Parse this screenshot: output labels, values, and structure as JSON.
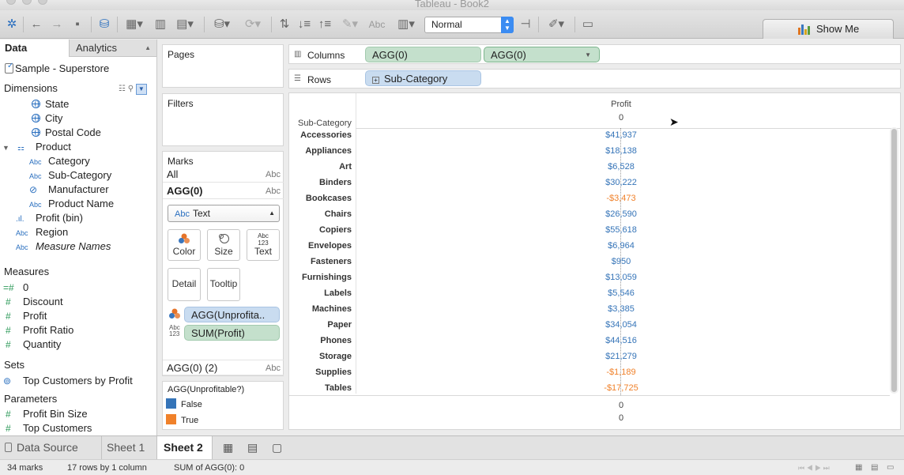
{
  "window": {
    "title": "Tableau - Book2"
  },
  "toolbar": {
    "fit_select": "Normal",
    "abc_label": "Abc",
    "show_me_label": "Show Me"
  },
  "left_panel": {
    "tabs": {
      "data": "Data",
      "analytics": "Analytics"
    },
    "data_source": "Sample - Superstore",
    "dimensions_header": "Dimensions",
    "dimensions": {
      "state": "State",
      "city": "City",
      "postal_code": "Postal Code",
      "product": "Product",
      "category": "Category",
      "sub_category": "Sub-Category",
      "manufacturer": "Manufacturer",
      "product_name": "Product Name",
      "profit_bin": "Profit (bin)",
      "region": "Region",
      "measure_names": "Measure Names"
    },
    "measures_header": "Measures",
    "measures": {
      "zero": "0",
      "discount": "Discount",
      "profit": "Profit",
      "profit_ratio": "Profit Ratio",
      "quantity": "Quantity"
    },
    "sets_header": "Sets",
    "sets": {
      "top_customers": "Top Customers by Profit"
    },
    "parameters_header": "Parameters",
    "parameters": {
      "profit_bin_size": "Profit Bin Size",
      "top_customers": "Top Customers"
    }
  },
  "cards": {
    "pages": "Pages",
    "filters": "Filters",
    "marks": {
      "header": "Marks",
      "all": "All",
      "agg0": "AGG(0)",
      "agg0_2": "AGG(0) (2)",
      "abc": "Abc",
      "mark_type": "Text",
      "color": "Color",
      "size": "Size",
      "text": "Text",
      "detail": "Detail",
      "tooltip": "Tooltip",
      "pill_color": "AGG(Unprofita..",
      "pill_text": "SUM(Profit)"
    },
    "legend": {
      "title": "AGG(Unprofitable?)",
      "items": [
        {
          "label": "False",
          "color": "#3574b8"
        },
        {
          "label": "True",
          "color": "#f0812a"
        }
      ]
    }
  },
  "shelves": {
    "columns_label": "Columns",
    "columns_pills": [
      "AGG(0)",
      "AGG(0)"
    ],
    "rows_label": "Rows",
    "rows_pill": "Sub-Category"
  },
  "view": {
    "column_header": "Profit",
    "top_axis_value": "0",
    "row_header": "Sub-Category",
    "rows": [
      {
        "label": "Accessories",
        "value": "$41,937",
        "profitable": true
      },
      {
        "label": "Appliances",
        "value": "$18,138",
        "profitable": true
      },
      {
        "label": "Art",
        "value": "$6,528",
        "profitable": true
      },
      {
        "label": "Binders",
        "value": "$30,222",
        "profitable": true
      },
      {
        "label": "Bookcases",
        "value": "-$3,473",
        "profitable": false
      },
      {
        "label": "Chairs",
        "value": "$26,590",
        "profitable": true
      },
      {
        "label": "Copiers",
        "value": "$55,618",
        "profitable": true
      },
      {
        "label": "Envelopes",
        "value": "$6,964",
        "profitable": true
      },
      {
        "label": "Fasteners",
        "value": "$950",
        "profitable": true
      },
      {
        "label": "Furnishings",
        "value": "$13,059",
        "profitable": true
      },
      {
        "label": "Labels",
        "value": "$5,546",
        "profitable": true
      },
      {
        "label": "Machines",
        "value": "$3,385",
        "profitable": true
      },
      {
        "label": "Paper",
        "value": "$34,054",
        "profitable": true
      },
      {
        "label": "Phones",
        "value": "$44,516",
        "profitable": true
      },
      {
        "label": "Storage",
        "value": "$21,279",
        "profitable": true
      },
      {
        "label": "Supplies",
        "value": "-$1,189",
        "profitable": false
      },
      {
        "label": "Tables",
        "value": "-$17,725",
        "profitable": false
      }
    ],
    "bottom_axis_values": [
      "0",
      "0"
    ],
    "colors": {
      "profitable": "#3574b8",
      "unprofitable": "#f0812a"
    }
  },
  "sheet_tabs": {
    "data_source": "Data Source",
    "sheet1": "Sheet 1",
    "sheet2": "Sheet 2"
  },
  "status": {
    "marks": "34 marks",
    "rows_cols": "17 rows by 1 column",
    "sum": "SUM of AGG(0): 0"
  }
}
